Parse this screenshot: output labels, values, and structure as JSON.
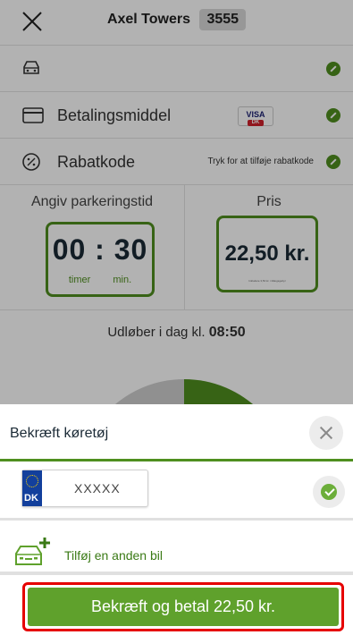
{
  "header": {
    "zone_name": "Axel Towers",
    "zone_code": "3555"
  },
  "settings": {
    "vehicle_label": "",
    "payment_label": "Betalingsmiddel",
    "payment_card": "VISA",
    "payment_card_sub": "DK",
    "promo_label": "Rabatkode",
    "promo_hint": "Tryk for at tilføje rabatkode"
  },
  "duration": {
    "title": "Angiv parkeringstid",
    "hours": "00",
    "separator": ":",
    "minutes": "30",
    "hours_unit": "timer",
    "minutes_unit": "min."
  },
  "price": {
    "title": "Pris",
    "amount": "22,50 kr.",
    "fine_print": "Inkludere 3,50 kr. i tillægsgebyr"
  },
  "expiry": {
    "text": "Udløber i dag kl.",
    "time": "08:50"
  },
  "dial": {
    "fraction_selected": 0.25
  },
  "sheet": {
    "title": "Bekræft køretøj",
    "plate_country": "DK",
    "plate_number": "XXXXX",
    "add_vehicle_label": "Tilføj en anden bil",
    "pay_button_label": "Bekræft og betal 22,50 kr."
  },
  "colors": {
    "accent_green": "#5fa12c",
    "highlight_red": "#e60000",
    "plate_blue": "#123f9c"
  }
}
